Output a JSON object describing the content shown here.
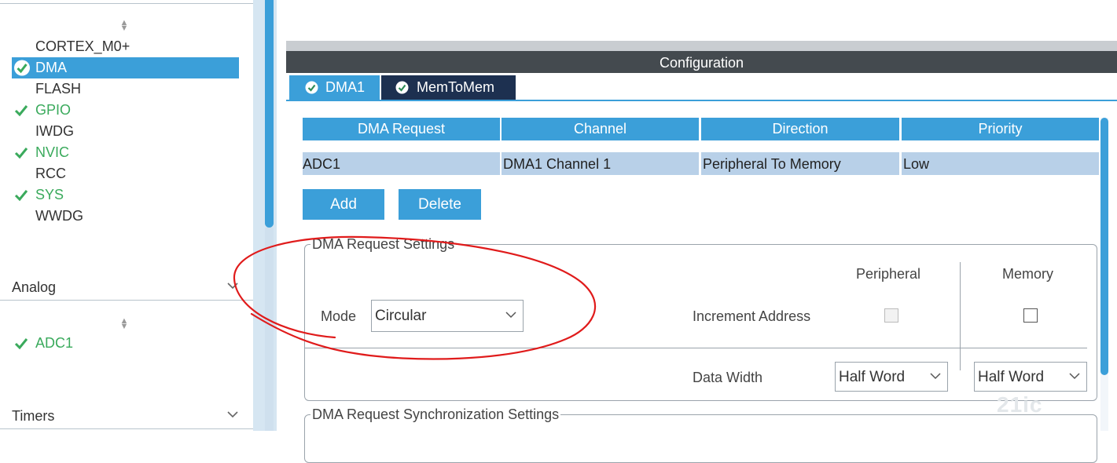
{
  "sidebar": {
    "categories": [
      {
        "label": "CORTEX_M0+",
        "status": "none"
      },
      {
        "label": "DMA",
        "status": "ok-selected"
      },
      {
        "label": "FLASH",
        "status": "none"
      },
      {
        "label": "GPIO",
        "status": "ok"
      },
      {
        "label": "IWDG",
        "status": "none"
      },
      {
        "label": "NVIC",
        "status": "ok"
      },
      {
        "label": "RCC",
        "status": "none"
      },
      {
        "label": "SYS",
        "status": "ok"
      },
      {
        "label": "WWDG",
        "status": "none"
      }
    ],
    "analog": {
      "header": "Analog",
      "items": [
        {
          "label": "ADC1",
          "status": "ok"
        }
      ]
    },
    "timers": {
      "header": "Timers"
    }
  },
  "config": {
    "title": "Configuration",
    "tabs": [
      {
        "label": "DMA1",
        "active": false
      },
      {
        "label": "MemToMem",
        "active": true
      }
    ],
    "table": {
      "headers": [
        "DMA Request",
        "Channel",
        "Direction",
        "Priority"
      ],
      "rows": [
        [
          "ADC1",
          "DMA1 Channel 1",
          "Peripheral To Memory",
          "Low"
        ]
      ]
    },
    "buttons": {
      "add": "Add",
      "delete": "Delete"
    },
    "settings": {
      "legend": "DMA Request Settings",
      "mode_label": "Mode",
      "mode_value": "Circular",
      "peripheral_header": "Peripheral",
      "memory_header": "Memory",
      "increment_label": "Increment Address",
      "increment_peripheral": false,
      "increment_memory": false,
      "data_width_label": "Data Width",
      "data_width_peripheral": "Half Word",
      "data_width_memory": "Half Word"
    },
    "sync_legend": "DMA Request Synchronization Settings"
  },
  "watermark": "21ic",
  "colors": {
    "accent": "#3b9fd9",
    "ok_green": "#3aaa5c",
    "config_bar": "#444a4f",
    "selected_row": "#b8d0e8",
    "annotation_red": "#e01b1b"
  }
}
